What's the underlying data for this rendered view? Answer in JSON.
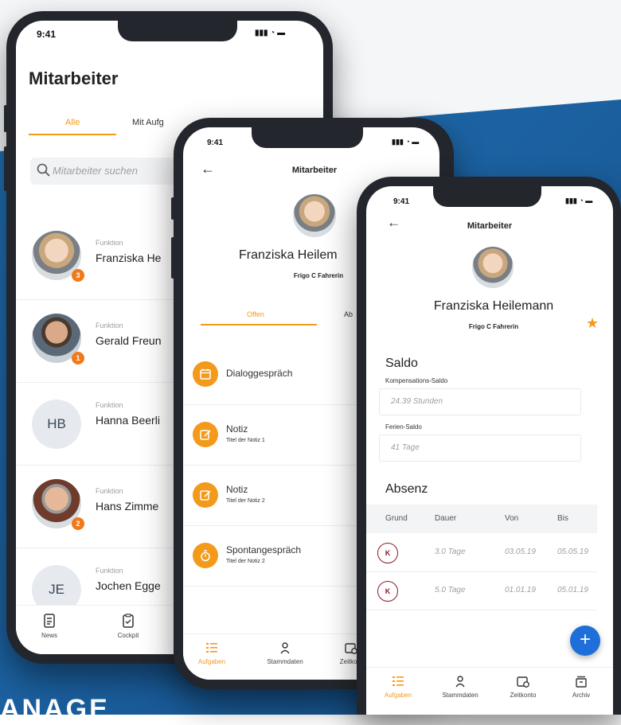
{
  "background": {
    "word": "ANAGE",
    "blue": "#1f6fb4",
    "accent": "#f39a1b"
  },
  "phone1": {
    "time": "9:41",
    "status": "▮▮▮ ◔ ▬",
    "title": "Mitarbeiter",
    "tabs": [
      "Alle",
      "Mit Aufg"
    ],
    "search_placeholder": "Mitarbeiter suchen",
    "employees": [
      {
        "function_label": "Funktion",
        "name": "Franziska He",
        "badge": "3",
        "avatar": "photo-woman-beanie"
      },
      {
        "function_label": "Funktion",
        "name": "Gerald Freun",
        "badge": "1",
        "avatar": "photo-man"
      },
      {
        "function_label": "Funktion",
        "name": "Hanna Beerli",
        "initials": "HB"
      },
      {
        "function_label": "Funktion",
        "name": "Hans Zimme",
        "badge": "2",
        "avatar": "photo-man-glasses"
      },
      {
        "function_label": "Funktion",
        "name": "Jochen Egge",
        "initials": "JE"
      }
    ],
    "nav": [
      {
        "label": "News",
        "icon": "news-icon"
      },
      {
        "label": "Cockpit",
        "icon": "clipboard-icon"
      }
    ]
  },
  "phone2": {
    "time": "9:41",
    "title": "Mitarbeiter",
    "name": "Franziska Heilem",
    "role": "Frigo C Fahrerin",
    "tabs": [
      "Offen",
      "Ab"
    ],
    "tasks": [
      {
        "title": "Dialoggespräch",
        "subtitle": "",
        "icon": "calendar-icon"
      },
      {
        "title": "Notiz",
        "subtitle": "Titel der Notiz 1",
        "icon": "edit-icon"
      },
      {
        "title": "Notiz",
        "subtitle": "Titel der Notiz 2",
        "icon": "edit-icon"
      },
      {
        "title": "Spontangespräch",
        "subtitle": "Titel der Notiz 2",
        "icon": "stopwatch-icon"
      }
    ],
    "nav": [
      {
        "label": "Aufgaben",
        "icon": "list-icon"
      },
      {
        "label": "Stammdaten",
        "icon": "person-icon"
      },
      {
        "label": "Zeitkont",
        "icon": "calendar-clock-icon"
      }
    ]
  },
  "phone3": {
    "time": "9:41",
    "title": "Mitarbeiter",
    "name": "Franziska Heilemann",
    "role": "Frigo C Fahrerin",
    "saldo": {
      "heading": "Saldo",
      "comp_label": "Kompensations-Saldo",
      "comp_value": "24.39 Stunden",
      "vac_label": "Ferien-Saldo",
      "vac_value": "41 Tage"
    },
    "absenz": {
      "heading": "Absenz",
      "columns": [
        "Grund",
        "Dauer",
        "Von",
        "Bis"
      ],
      "rows": [
        {
          "grund": "K",
          "dauer": "3.0 Tage",
          "von": "03.05.19",
          "bis": "05.05.19"
        },
        {
          "grund": "K",
          "dauer": "5.0 Tage",
          "von": "01.01.19",
          "bis": "05.01.19"
        }
      ]
    },
    "fab": "+",
    "nav": [
      {
        "label": "Aufgaben",
        "icon": "list-icon"
      },
      {
        "label": "Stammdaten",
        "icon": "person-icon"
      },
      {
        "label": "Zeitkonto",
        "icon": "calendar-clock-icon"
      },
      {
        "label": "Archiv",
        "icon": "archive-icon"
      }
    ]
  }
}
